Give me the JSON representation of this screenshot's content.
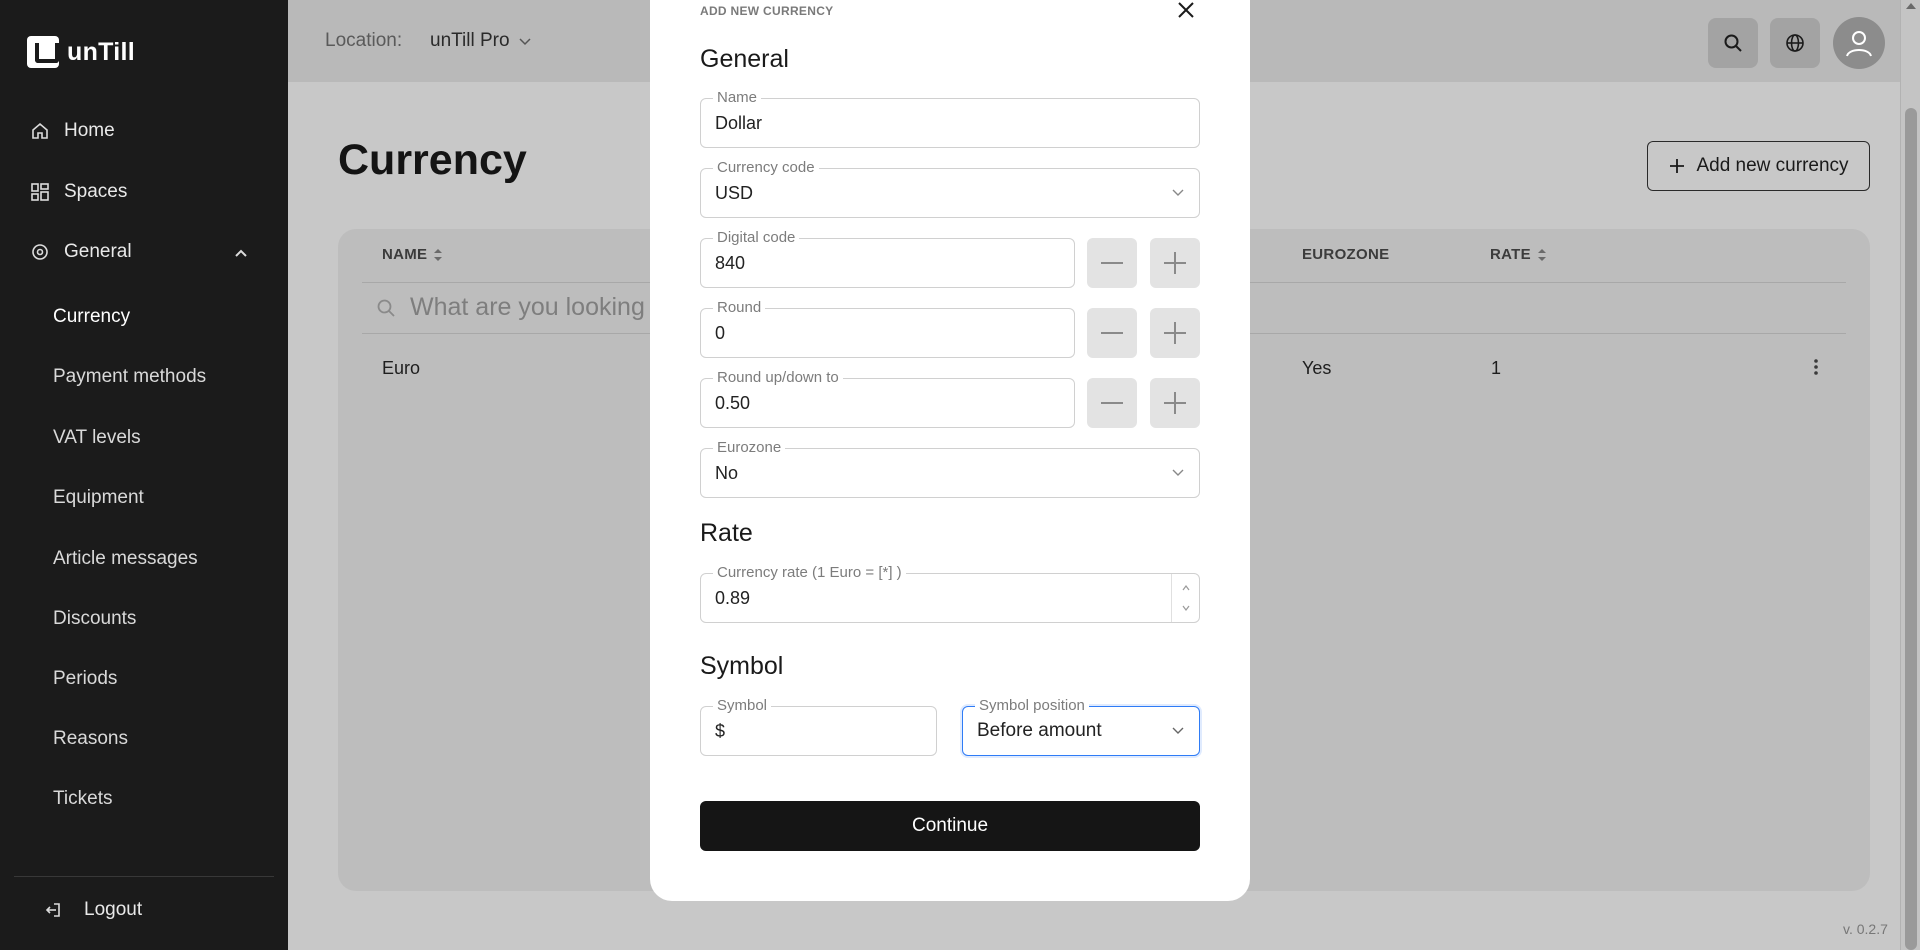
{
  "sidebar": {
    "brand": "unTill",
    "nav": {
      "home": "Home",
      "spaces": "Spaces",
      "general": "General"
    },
    "sub_items": [
      "Currency",
      "Payment methods",
      "VAT levels",
      "Equipment",
      "Article messages",
      "Discounts",
      "Periods",
      "Reasons",
      "Tickets"
    ],
    "active_item": "Currency",
    "logout": "Logout"
  },
  "header": {
    "location_label": "Location:",
    "location_value": "unTill Pro"
  },
  "main": {
    "title": "Currency",
    "add_button": "Add new currency",
    "columns": {
      "name": "NAME",
      "eurozone": "EUROZONE",
      "rate": "RATE"
    },
    "search_placeholder": "What are you looking",
    "rows": [
      {
        "name": "Euro",
        "eurozone": "Yes",
        "rate": "1"
      }
    ],
    "version": "v. 0.2.7"
  },
  "modal": {
    "title": "ADD NEW CURRENCY",
    "general_section": "General",
    "name": {
      "label": "Name",
      "value": "Dollar"
    },
    "currency_code": {
      "label": "Currency code",
      "value": "USD"
    },
    "digital_code": {
      "label": "Digital code",
      "value": "840"
    },
    "round": {
      "label": "Round",
      "value": "0"
    },
    "round_to": {
      "label": "Round up/down to",
      "value": "0.50"
    },
    "eurozone": {
      "label": "Eurozone",
      "value": "No"
    },
    "rate_section": "Rate",
    "currency_rate": {
      "label": "Currency rate (1 Euro = [*] )",
      "value": "0.89"
    },
    "symbol_section": "Symbol",
    "symbol": {
      "label": "Symbol",
      "value": "$"
    },
    "symbol_position": {
      "label": "Symbol position",
      "value": "Before amount"
    },
    "continue_button": "Continue"
  },
  "colors": {
    "sidebar_bg": "#1b1b1b",
    "overlay_bg": "#c8c8c8",
    "primary_button": "#151515",
    "focus_ring": "#2f7cf6"
  }
}
